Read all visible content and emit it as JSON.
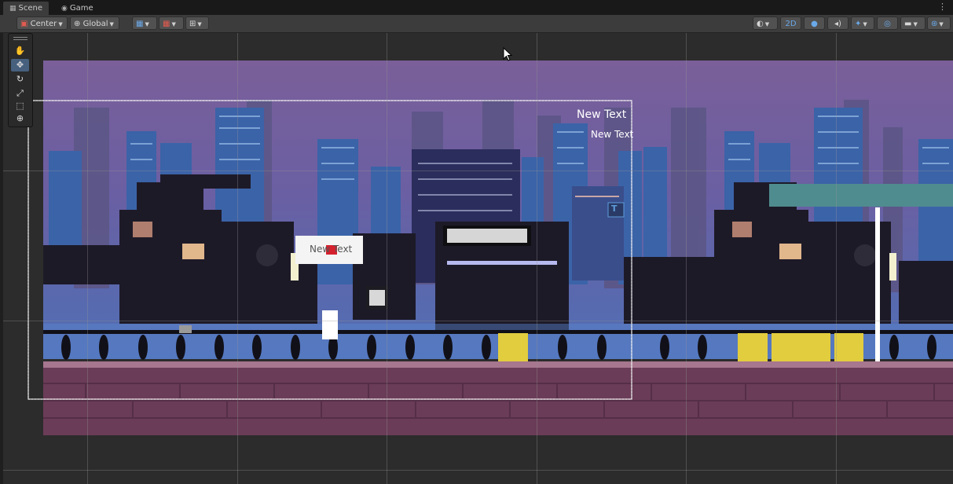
{
  "tabs": [
    {
      "label": "Scene",
      "icon": "grid-icon"
    },
    {
      "label": "Game",
      "icon": "gamepad-icon"
    }
  ],
  "toolbar": {
    "pivot_label": "Center",
    "space_label": "Global",
    "view_2d_label": "2D"
  },
  "scene_texts": {
    "text1": "New Text",
    "text2": "New Text",
    "text3": "New Text"
  },
  "colors": {
    "active_tool": "#46607e",
    "sky_top": "#7a5f99",
    "sky_bottom": "#4f6fb5",
    "wall": "#6a3c57",
    "yellow": "#e2cd3e",
    "teal": "#4f8c8f"
  }
}
